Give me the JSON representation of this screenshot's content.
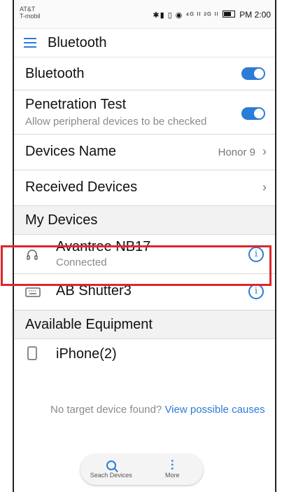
{
  "status_bar": {
    "carrier": [
      "AT&T",
      "T-mobil"
    ],
    "indicators": "✱▮ ▯ ◉ ⁴ᴳ ᴵᴵ ²ᴳ ᴵᴵ",
    "time": "PM 2:00"
  },
  "app_bar": {
    "title": "Bluetooth"
  },
  "settings": {
    "bluetooth": {
      "label": "Bluetooth",
      "enabled": true
    },
    "penetration_test": {
      "label": "Penetration Test",
      "description": "Allow peripheral devices to be checked",
      "enabled": true
    },
    "devices_name": {
      "label": "Devices Name",
      "value": "Honor 9"
    },
    "received_devices": {
      "label": "Received Devices"
    }
  },
  "my_devices": {
    "header": "My Devices",
    "items": [
      {
        "name": "Avantree NB17",
        "status": "Connected",
        "icon": "headphones-icon"
      },
      {
        "name": "AB Shutter3",
        "status": "",
        "icon": "keyboard-icon"
      }
    ]
  },
  "available": {
    "header": "Available Equipment",
    "items": [
      {
        "name": "iPhone(2)",
        "icon": "phone-icon"
      }
    ],
    "note_prefix": "No target device found? ",
    "note_link": "View possible causes"
  },
  "bottom_bar": {
    "search_label": "Seach Devices",
    "more_label": "More"
  },
  "colors": {
    "accent": "#2b7bd8",
    "highlight": "#e0262d"
  }
}
